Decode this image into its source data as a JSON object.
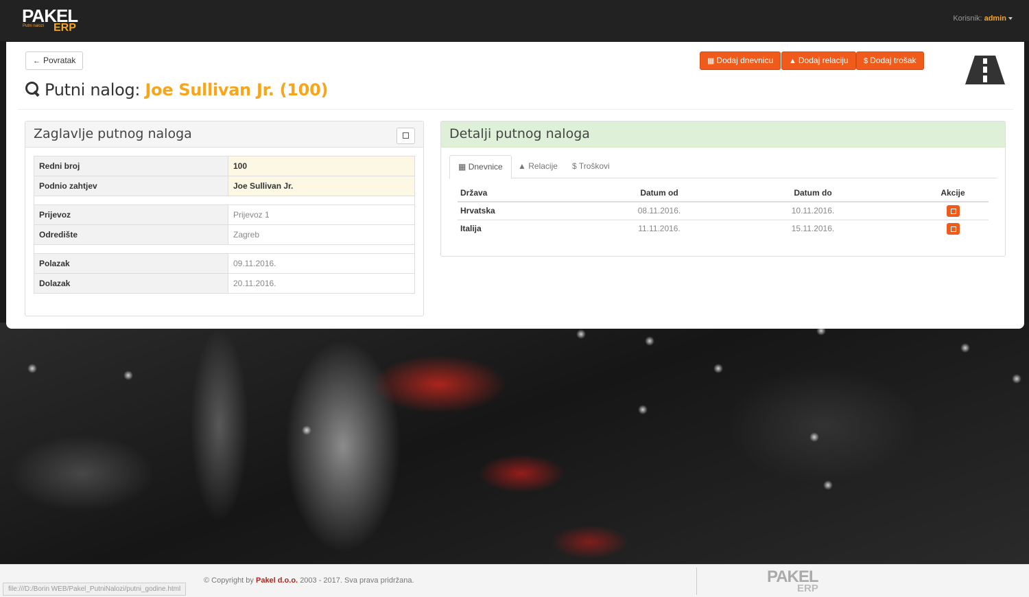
{
  "navbar": {
    "logo_text": "PAKEL",
    "logo_erp": "ERP",
    "logo_sub": "Putni nalozi",
    "user_label": "Korisnik:",
    "user_name": "admin"
  },
  "toolbar": {
    "back_label": "Povratak",
    "add_daily_label": "Dodaj dnevnicu",
    "add_route_label": "Dodaj relaciju",
    "add_cost_label": "Dodaj trošak"
  },
  "page": {
    "title_prefix": "Putni nalog:",
    "title_name": "Joe Sullivan Jr. (100)"
  },
  "header_panel": {
    "title": "Zaglavlje putnog naloga",
    "rows": [
      {
        "label": "Redni broj",
        "value": "100"
      },
      {
        "label": "Podnio zahtjev",
        "value": "Joe Sullivan Jr."
      },
      {
        "label": "Prijevoz",
        "value": "Prijevoz 1"
      },
      {
        "label": "Odredište",
        "value": "Zagreb"
      },
      {
        "label": "Polazak",
        "value": "09.11.2016."
      },
      {
        "label": "Dolazak",
        "value": "20.11.2016."
      }
    ]
  },
  "details_panel": {
    "title": "Detalji putnog naloga",
    "tabs": [
      "Dnevnice",
      "Relacije",
      "Troškovi"
    ],
    "columns": [
      "Država",
      "Datum od",
      "Datum do",
      "Akcije"
    ],
    "rows": [
      {
        "country": "Hrvatska",
        "from": "08.11.2016.",
        "to": "10.11.2016."
      },
      {
        "country": "Italija",
        "from": "11.11.2016.",
        "to": "15.11.2016."
      }
    ]
  },
  "footer": {
    "copyright_prefix": "© Copyright by",
    "company": "Pakel d.o.o.",
    "copyright_suffix": "2003 - 2017. Sva prava pridržana.",
    "logo_text": "PAKEL",
    "logo_erp": "ERP"
  },
  "statusbar": {
    "url": "file:///D:/Borin WEB/Pakel_PutniNalozi/putni_godine.html"
  },
  "colors": {
    "accent": "#f7a51c",
    "button": "#f05a1a",
    "panel_green": "#dff0d8",
    "highlight": "#fcf8e3"
  }
}
